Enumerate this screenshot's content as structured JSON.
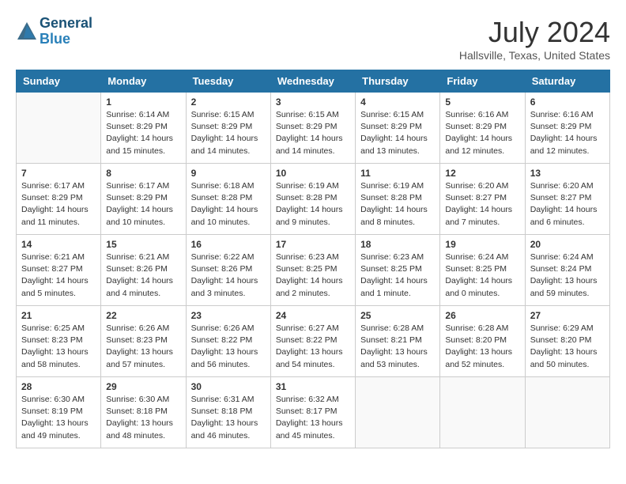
{
  "header": {
    "logo_line1": "General",
    "logo_line2": "Blue",
    "month_year": "July 2024",
    "location": "Hallsville, Texas, United States"
  },
  "days_of_week": [
    "Sunday",
    "Monday",
    "Tuesday",
    "Wednesday",
    "Thursday",
    "Friday",
    "Saturday"
  ],
  "weeks": [
    [
      {
        "day": "",
        "empty": true
      },
      {
        "day": "1",
        "sunrise": "6:14 AM",
        "sunset": "8:29 PM",
        "daylight": "14 hours and 15 minutes."
      },
      {
        "day": "2",
        "sunrise": "6:15 AM",
        "sunset": "8:29 PM",
        "daylight": "14 hours and 14 minutes."
      },
      {
        "day": "3",
        "sunrise": "6:15 AM",
        "sunset": "8:29 PM",
        "daylight": "14 hours and 14 minutes."
      },
      {
        "day": "4",
        "sunrise": "6:15 AM",
        "sunset": "8:29 PM",
        "daylight": "14 hours and 13 minutes."
      },
      {
        "day": "5",
        "sunrise": "6:16 AM",
        "sunset": "8:29 PM",
        "daylight": "14 hours and 12 minutes."
      },
      {
        "day": "6",
        "sunrise": "6:16 AM",
        "sunset": "8:29 PM",
        "daylight": "14 hours and 12 minutes."
      }
    ],
    [
      {
        "day": "7",
        "sunrise": "6:17 AM",
        "sunset": "8:29 PM",
        "daylight": "14 hours and 11 minutes."
      },
      {
        "day": "8",
        "sunrise": "6:17 AM",
        "sunset": "8:29 PM",
        "daylight": "14 hours and 10 minutes."
      },
      {
        "day": "9",
        "sunrise": "6:18 AM",
        "sunset": "8:28 PM",
        "daylight": "14 hours and 10 minutes."
      },
      {
        "day": "10",
        "sunrise": "6:19 AM",
        "sunset": "8:28 PM",
        "daylight": "14 hours and 9 minutes."
      },
      {
        "day": "11",
        "sunrise": "6:19 AM",
        "sunset": "8:28 PM",
        "daylight": "14 hours and 8 minutes."
      },
      {
        "day": "12",
        "sunrise": "6:20 AM",
        "sunset": "8:27 PM",
        "daylight": "14 hours and 7 minutes."
      },
      {
        "day": "13",
        "sunrise": "6:20 AM",
        "sunset": "8:27 PM",
        "daylight": "14 hours and 6 minutes."
      }
    ],
    [
      {
        "day": "14",
        "sunrise": "6:21 AM",
        "sunset": "8:27 PM",
        "daylight": "14 hours and 5 minutes."
      },
      {
        "day": "15",
        "sunrise": "6:21 AM",
        "sunset": "8:26 PM",
        "daylight": "14 hours and 4 minutes."
      },
      {
        "day": "16",
        "sunrise": "6:22 AM",
        "sunset": "8:26 PM",
        "daylight": "14 hours and 3 minutes."
      },
      {
        "day": "17",
        "sunrise": "6:23 AM",
        "sunset": "8:25 PM",
        "daylight": "14 hours and 2 minutes."
      },
      {
        "day": "18",
        "sunrise": "6:23 AM",
        "sunset": "8:25 PM",
        "daylight": "14 hours and 1 minute."
      },
      {
        "day": "19",
        "sunrise": "6:24 AM",
        "sunset": "8:25 PM",
        "daylight": "14 hours and 0 minutes."
      },
      {
        "day": "20",
        "sunrise": "6:24 AM",
        "sunset": "8:24 PM",
        "daylight": "13 hours and 59 minutes."
      }
    ],
    [
      {
        "day": "21",
        "sunrise": "6:25 AM",
        "sunset": "8:23 PM",
        "daylight": "13 hours and 58 minutes."
      },
      {
        "day": "22",
        "sunrise": "6:26 AM",
        "sunset": "8:23 PM",
        "daylight": "13 hours and 57 minutes."
      },
      {
        "day": "23",
        "sunrise": "6:26 AM",
        "sunset": "8:22 PM",
        "daylight": "13 hours and 56 minutes."
      },
      {
        "day": "24",
        "sunrise": "6:27 AM",
        "sunset": "8:22 PM",
        "daylight": "13 hours and 54 minutes."
      },
      {
        "day": "25",
        "sunrise": "6:28 AM",
        "sunset": "8:21 PM",
        "daylight": "13 hours and 53 minutes."
      },
      {
        "day": "26",
        "sunrise": "6:28 AM",
        "sunset": "8:20 PM",
        "daylight": "13 hours and 52 minutes."
      },
      {
        "day": "27",
        "sunrise": "6:29 AM",
        "sunset": "8:20 PM",
        "daylight": "13 hours and 50 minutes."
      }
    ],
    [
      {
        "day": "28",
        "sunrise": "6:30 AM",
        "sunset": "8:19 PM",
        "daylight": "13 hours and 49 minutes."
      },
      {
        "day": "29",
        "sunrise": "6:30 AM",
        "sunset": "8:18 PM",
        "daylight": "13 hours and 48 minutes."
      },
      {
        "day": "30",
        "sunrise": "6:31 AM",
        "sunset": "8:18 PM",
        "daylight": "13 hours and 46 minutes."
      },
      {
        "day": "31",
        "sunrise": "6:32 AM",
        "sunset": "8:17 PM",
        "daylight": "13 hours and 45 minutes."
      },
      {
        "day": "",
        "empty": true
      },
      {
        "day": "",
        "empty": true
      },
      {
        "day": "",
        "empty": true
      }
    ]
  ],
  "labels": {
    "sunrise": "Sunrise:",
    "sunset": "Sunset:",
    "daylight": "Daylight:"
  }
}
